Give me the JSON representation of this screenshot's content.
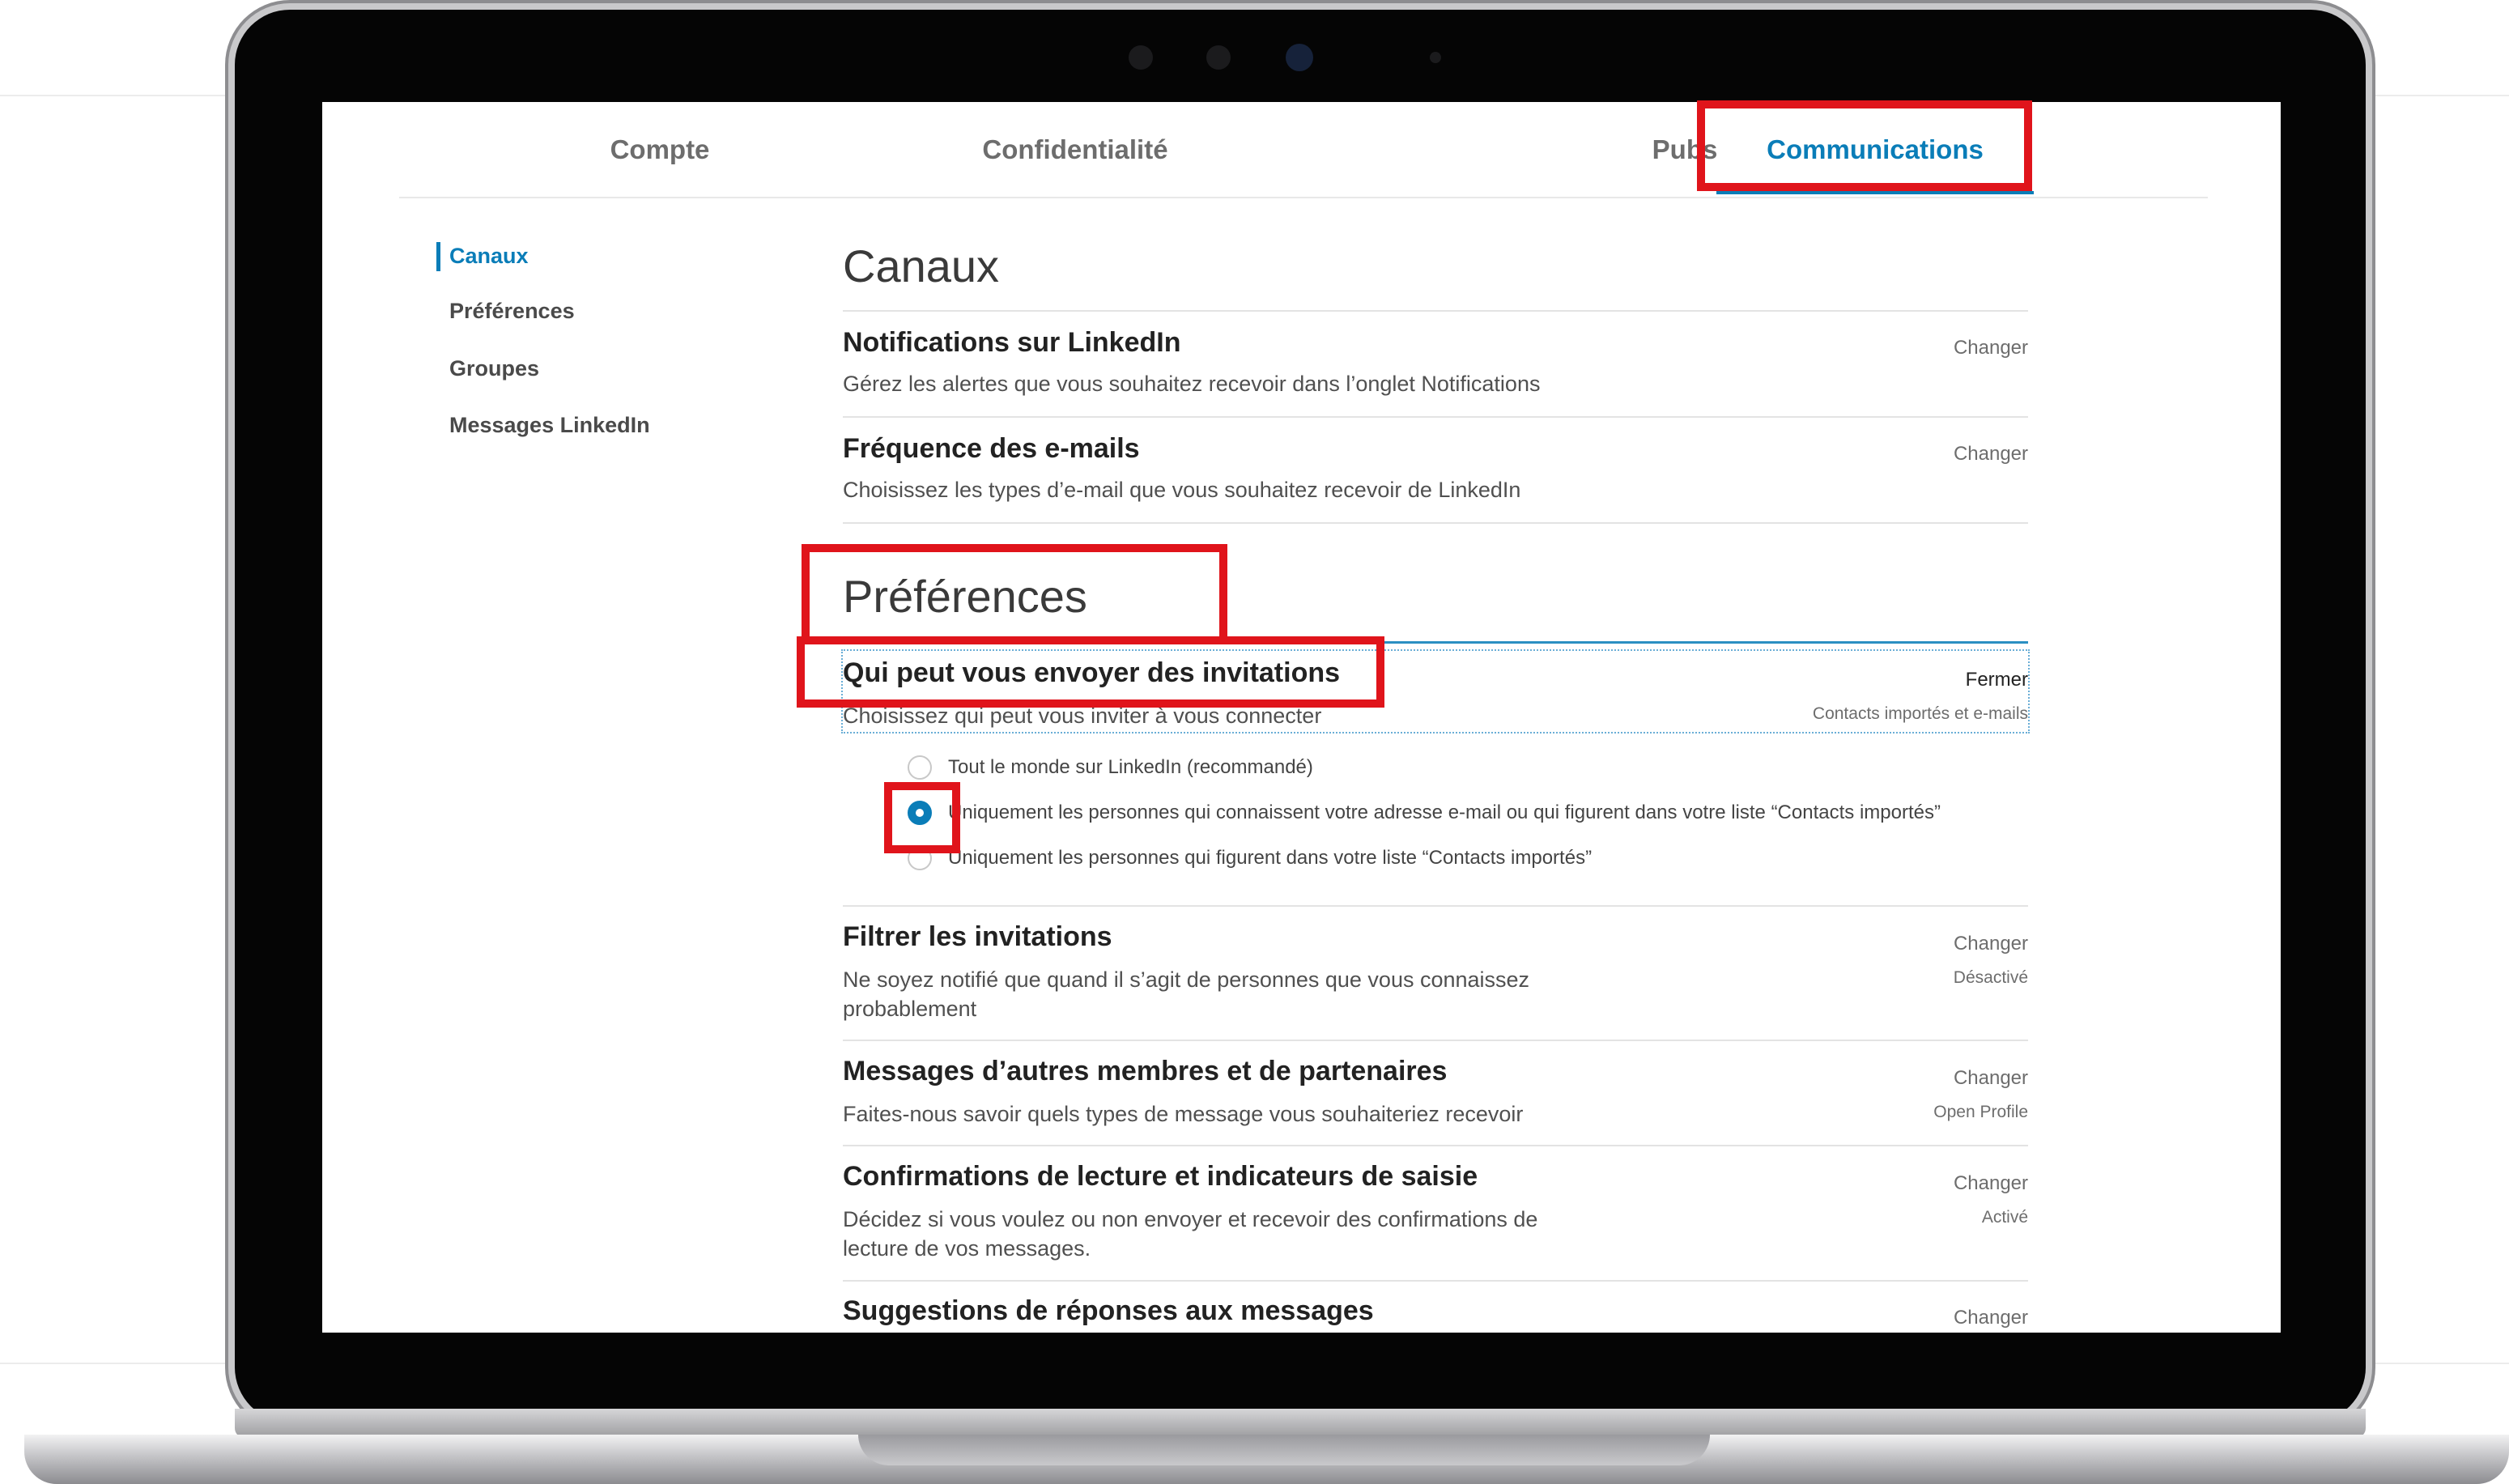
{
  "tabs": [
    {
      "label": "Compte",
      "active": false
    },
    {
      "label": "Confidentialité",
      "active": false
    },
    {
      "label": "Pubs",
      "active": false
    },
    {
      "label": "Communications",
      "active": true
    }
  ],
  "sidebar": {
    "items": [
      {
        "label": "Canaux",
        "active": true
      },
      {
        "label": "Préférences",
        "active": false
      },
      {
        "label": "Groupes",
        "active": false
      },
      {
        "label": "Messages LinkedIn",
        "active": false
      }
    ]
  },
  "sections": {
    "canaux": {
      "title": "Canaux",
      "rows": [
        {
          "title": "Notifications sur LinkedIn",
          "desc": "Gérez les alertes que vous souhaitez recevoir dans l’onglet Notifications",
          "action": "Changer"
        },
        {
          "title": "Fréquence des e-mails",
          "desc": "Choisissez les types d’e-mail que vous souhaitez recevoir de LinkedIn",
          "action": "Changer"
        }
      ]
    },
    "preferences": {
      "title": "Préférences",
      "invitations": {
        "title": "Qui peut vous envoyer des invitations",
        "desc": "Choisissez qui peut vous inviter à vous connecter",
        "action": "Fermer",
        "status": "Contacts importés et e-mails",
        "options": [
          {
            "label": "Tout le monde sur LinkedIn (recommandé)",
            "checked": false
          },
          {
            "label": "Uniquement les personnes qui connaissent votre adresse e-mail ou qui figurent dans votre liste “Contacts importés”",
            "checked": true
          },
          {
            "label": "Uniquement les personnes qui figurent dans votre liste “Contacts importés”",
            "checked": false
          }
        ]
      },
      "rows": [
        {
          "title": "Filtrer les invitations",
          "desc": "Ne soyez notifié que quand il s’agit de personnes que vous connaissez probablement",
          "action": "Changer",
          "status": "Désactivé"
        },
        {
          "title": "Messages d’autres membres et de partenaires",
          "desc": "Faites-nous savoir quels types de message vous souhaiteriez recevoir",
          "action": "Changer",
          "status": "Open Profile"
        },
        {
          "title": "Confirmations de lecture et indicateurs de saisie",
          "desc": "Décidez si vous voulez ou non envoyer et recevoir des confirmations de lecture de vos messages.",
          "action": "Changer",
          "status": "Activé"
        },
        {
          "title": "Suggestions de réponses aux messages",
          "desc": "",
          "action": "Changer",
          "status": ""
        }
      ]
    }
  },
  "colors": {
    "accent": "#0a7db8",
    "highlight": "#e0141b"
  }
}
